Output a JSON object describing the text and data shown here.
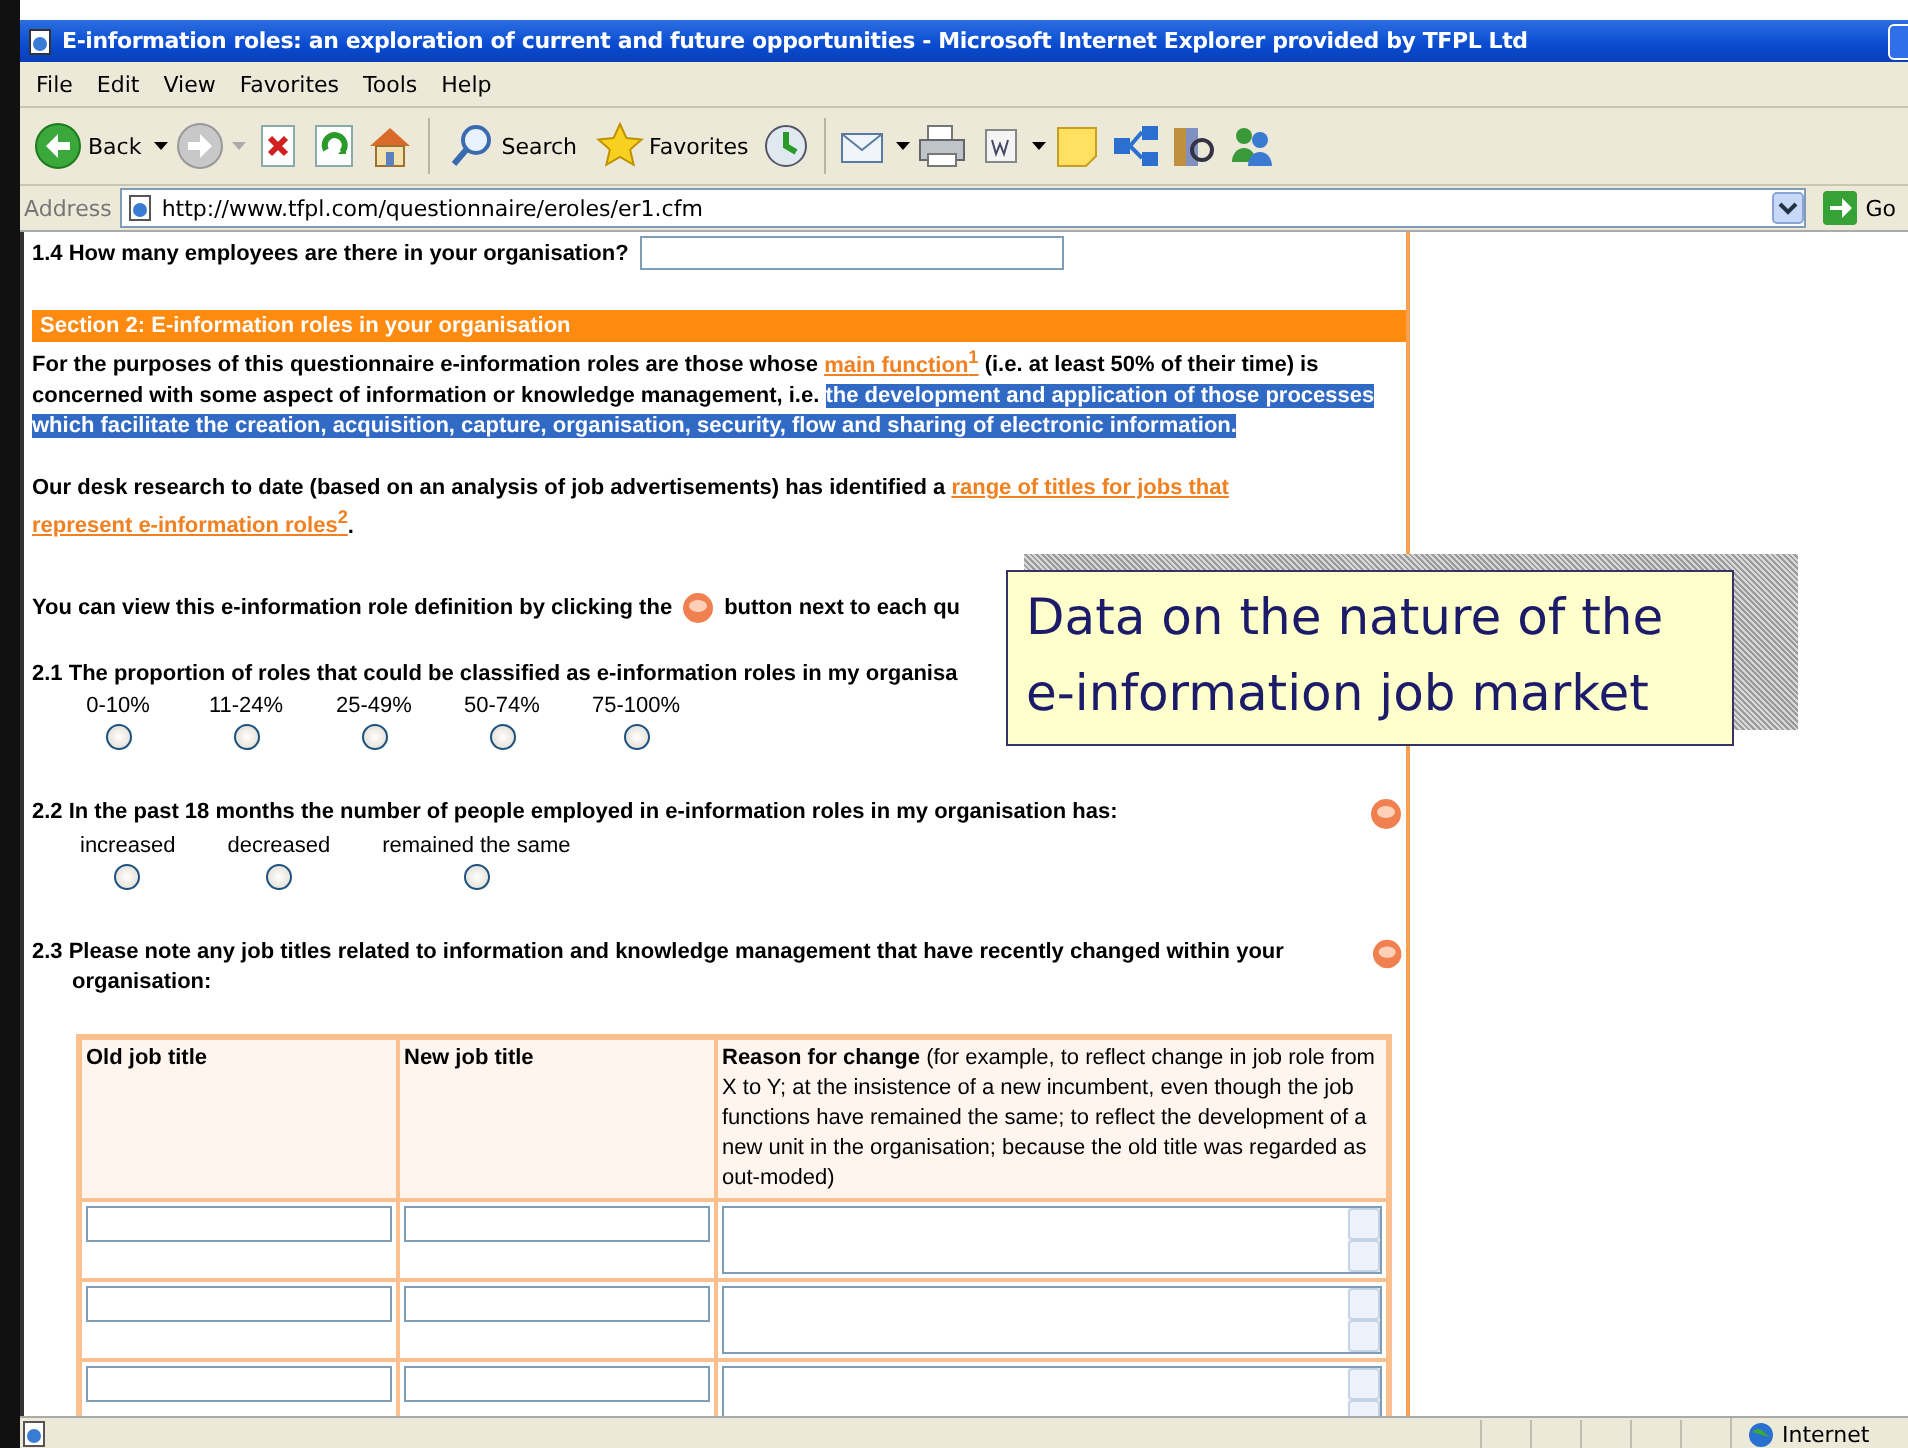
{
  "window": {
    "title": "E-information roles: an exploration of current and future opportunities - Microsoft Internet Explorer provided by TFPL Ltd"
  },
  "menu": [
    {
      "label": "File"
    },
    {
      "label": "Edit"
    },
    {
      "label": "View"
    },
    {
      "label": "Favorites"
    },
    {
      "label": "Tools"
    },
    {
      "label": "Help"
    }
  ],
  "toolbar": {
    "back": "Back",
    "search": "Search",
    "favorites": "Favorites"
  },
  "address": {
    "label": "Address",
    "url": "http://www.tfpl.com/questionnaire/eroles/er1.cfm",
    "go": "Go"
  },
  "form": {
    "q1_4": {
      "text": "1.4 How many employees are there in your organisation?"
    },
    "section": {
      "title": "Section 2: E-information roles in your organisation"
    },
    "intro": [
      {
        "parts": [
          {
            "kind": "text",
            "text": "For the purposes of this questionnaire e-information roles are those whose "
          },
          {
            "kind": "link",
            "text": "main function$^{1}$"
          },
          {
            "kind": "text",
            "text": " (i.e. at least 50% of their time) is concerned with some aspect of information or knowledge management, i.e. "
          },
          {
            "kind": "highlight",
            "text": "the development and application of those processes which facilitate the creation, acquisition, capture, organisation, security, flow and sharing of electronic information. "
          }
        ]
      },
      {
        "parts": [
          {
            "kind": "text",
            "text": "Our desk research to date (based on an analysis of job advertisements) has identified a "
          },
          {
            "kind": "link",
            "text": "range of titles for jobs that"
          },
          {
            "kind": "link",
            "text": "represent e-information roles$^{2}$"
          },
          {
            "kind": "text",
            "text": "."
          }
        ]
      }
    ],
    "instruction": {
      "before": "You can view this e-information role definition by clicking the",
      "after": "button next to each qu"
    },
    "questions": [
      {
        "text": "2.1 The proportion of roles that could be classified as e-information roles in my organisa",
        "info": false,
        "options": [
          {
            "label": "0-10%",
            "selected": false
          },
          {
            "label": "11-24%",
            "selected": false
          },
          {
            "label": "25-49%",
            "selected": false
          },
          {
            "label": "50-74%",
            "selected": false
          },
          {
            "label": "75-100%",
            "selected": false
          }
        ]
      },
      {
        "text": "2.2 In the past 18 months the number of people employed in e-information roles in my organisation has:",
        "info": true,
        "options": [
          {
            "label": "increased",
            "selected": false
          },
          {
            "label": "decreased",
            "selected": false
          },
          {
            "label": "remained the same",
            "selected": false
          }
        ]
      },
      {
        "text": "2.3 Please note any job titles related to information and knowledge management that have recently changed within your organisation:",
        "info": true
      }
    ],
    "table": {
      "columns": [
        {
          "label": "Old job title"
        },
        {
          "label": "New job title"
        },
        {
          "label": "**Reason for change** (for example, to reflect change in job role from X to Y; at the insistence of a new incumbent, even though the job functions have remained the same; to reflect the development of a new unit in the organisation; because the old title was regarded as out-moded)"
        }
      ],
      "rows": [
        {
          "kind": "entry"
        },
        {
          "kind": "entry"
        },
        {
          "kind": "entry"
        }
      ]
    }
  },
  "status": {
    "zone": "Internet"
  },
  "callout": {
    "text": "Data on the nature of the e-information job market"
  }
}
